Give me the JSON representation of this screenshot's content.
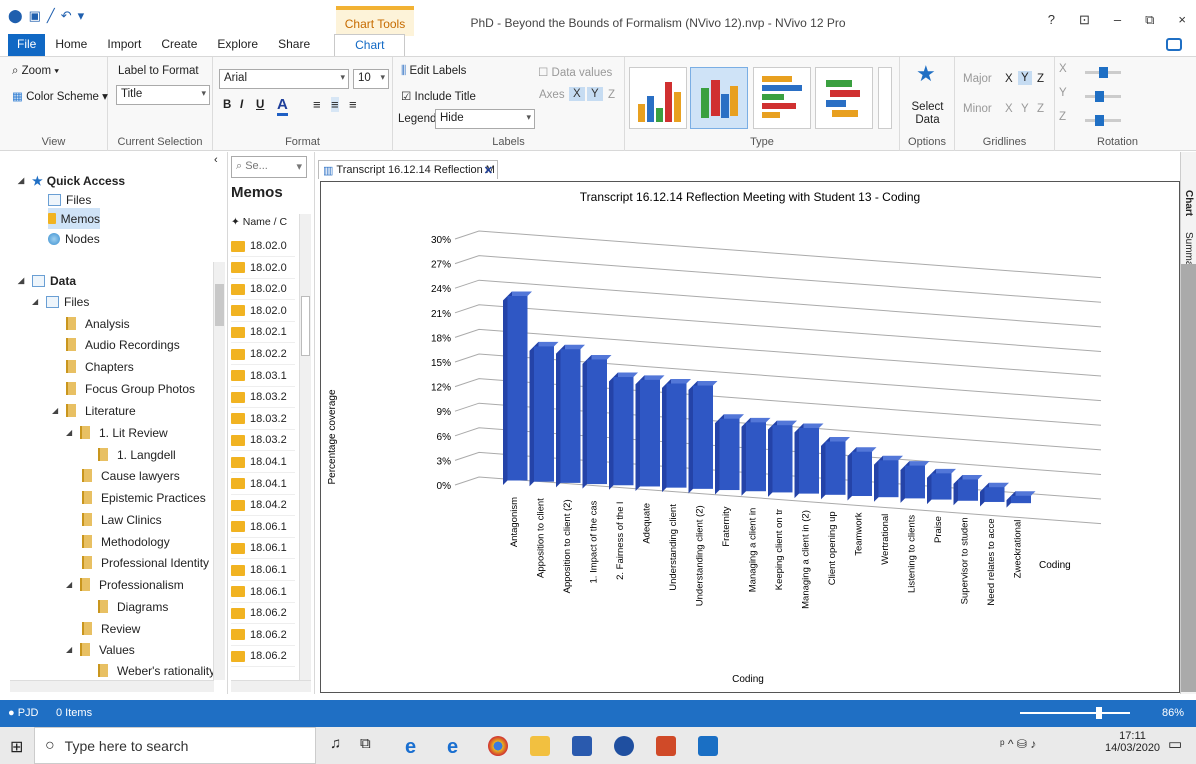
{
  "window": {
    "title": "PhD - Beyond the Bounds of Formalism (NVivo 12).nvp - NVivo 12 Pro",
    "context_tab": "Chart Tools",
    "controls": [
      "?",
      "⊡",
      "–",
      "⧉",
      "×"
    ]
  },
  "menu": {
    "tabs": [
      "File",
      "Home",
      "Import",
      "Create",
      "Explore",
      "Share",
      "Chart"
    ],
    "active": "Chart"
  },
  "ribbon": {
    "view": {
      "zoom": "Zoom",
      "color_scheme": "Color Scheme",
      "label": "View"
    },
    "selection": {
      "label_to_format": "Label to Format",
      "value": "Title",
      "label": "Current Selection"
    },
    "format": {
      "font": "Arial",
      "size": "10",
      "bold": "B",
      "italic": "I",
      "underline": "U",
      "label": "Format"
    },
    "labels": {
      "edit": "Edit Labels",
      "include_title": "Include Title",
      "legend_label": "Legend",
      "legend_value": "Hide",
      "data_values": "Data values",
      "axes": "Axes",
      "ax_x": "X",
      "ax_y": "Y",
      "ax_z": "Z",
      "label": "Labels"
    },
    "type": {
      "label": "Type"
    },
    "options": {
      "select_data": "Select Data",
      "label": "Options"
    },
    "gridlines": {
      "major": "Major",
      "minor": "Minor",
      "x": "X",
      "y": "Y",
      "z": "Z",
      "label": "Gridlines"
    },
    "rotation": {
      "x": "X",
      "y": "Y",
      "z": "Z",
      "label": "Rotation"
    }
  },
  "nav": {
    "quick_access": "Quick Access",
    "qa_items": [
      "Files",
      "Memos",
      "Nodes"
    ],
    "data": "Data",
    "files": "Files",
    "tree": [
      "Analysis",
      "Audio Recordings",
      "Chapters",
      "Focus Group Photos",
      "Literature",
      "1. Lit Review",
      "1. Langdell",
      "Cause lawyers",
      "Epistemic Practices",
      "Law Clinics",
      "Methodology",
      "Professional Identity",
      "Professionalism",
      "Diagrams",
      "Review",
      "Values",
      "Weber's rationality"
    ]
  },
  "memos": {
    "search": "Se...",
    "title": "Memos",
    "col_name": "Name",
    "col_c": "C",
    "rows": [
      "18.02.0",
      "18.02.0",
      "18.02.0",
      "18.02.0",
      "18.02.1",
      "18.02.2",
      "18.03.1",
      "18.03.2",
      "18.03.2",
      "18.03.2",
      "18.04.1",
      "18.04.1",
      "18.04.2",
      "18.06.1",
      "18.06.1",
      "18.06.1",
      "18.06.1",
      "18.06.2",
      "18.06.2",
      "18.06.2"
    ]
  },
  "doc_tab": "Transcript 16.12.14 Reflection M",
  "side_tabs": [
    "Chart",
    "Summary"
  ],
  "chart_data": {
    "type": "bar",
    "title": "Transcript 16.12.14 Reflection Meeting with Student 13 - Coding",
    "xlabel": "Coding",
    "ylabel": "Percentage coverage",
    "zlabel": "Coding",
    "ylim": [
      0,
      30
    ],
    "yticks": [
      "0%",
      "3%",
      "6%",
      "9%",
      "12%",
      "15%",
      "18%",
      "21%",
      "24%",
      "27%",
      "30%"
    ],
    "categories": [
      "Antagonism",
      "Apposition to client",
      "Apposition to client (2)",
      "1. Impact of the cas",
      "2. Fairness of the l",
      "Adequate",
      "Understanding client",
      "Understanding client (2)",
      "Fraternity",
      "Managing a client in",
      "Keeping client on tr",
      "Managing a client in (2)",
      "Client opening up",
      "Teamwork",
      "Wertrational",
      "Listening to clients",
      "Praise",
      "Supervisor to studen",
      "Need relates to acce",
      "Zweckrational"
    ],
    "values": [
      22.5,
      16.5,
      16.3,
      15.2,
      13.2,
      13.0,
      12.7,
      12.6,
      8.7,
      8.4,
      8.2,
      8.0,
      6.5,
      5.4,
      4.5,
      4.0,
      3.2,
      2.6,
      1.8,
      0.9
    ],
    "bar_color": "#2f57c4"
  },
  "status": {
    "user": "PJD",
    "items": "0 Items",
    "zoom": "86%"
  },
  "taskbar": {
    "search": "Type here to search",
    "time": "17:11",
    "date": "14/03/2020"
  }
}
